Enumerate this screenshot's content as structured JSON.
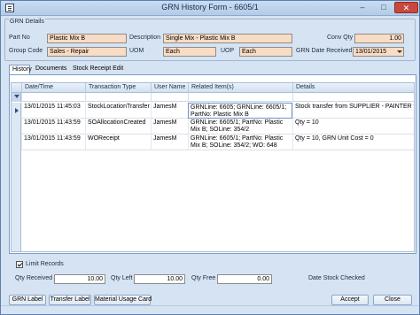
{
  "window": {
    "title": "GRN History Form - 6605/1",
    "close_glyph": "✕",
    "min_glyph": "–",
    "max_glyph": "□"
  },
  "details": {
    "group_title": "GRN Details",
    "part_no_label": "Part No",
    "part_no": "Plastic Mix B",
    "description_label": "Description",
    "description": "Single Mix - Plastic Mix B",
    "conv_qty_label": "Conv Qty",
    "conv_qty": "1.00",
    "group_code_label": "Group Code",
    "group_code": "Sales - Repair",
    "uom_label": "UOM",
    "uom": "Each",
    "uop_label": "UOP",
    "uop": "Each",
    "grn_date_label": "GRN Date Received:",
    "grn_date": "13/01/2015"
  },
  "tabs": [
    {
      "label": "History",
      "active": true
    },
    {
      "label": "Documents",
      "active": false
    },
    {
      "label": "Stock Receipt Edit",
      "active": false
    }
  ],
  "grid": {
    "columns": [
      "Date/Time",
      "Transaction Type",
      "User Name",
      "Related Item(s)",
      "Details"
    ],
    "rows": [
      {
        "datetime": "13/01/2015 11:45:03",
        "type": "StockLocationTransfer",
        "user": "JamesM",
        "related": "GRNLine: 6605; GRNLine: 6605/1; PartNo: Plastic Mix B",
        "details": "Stock transfer from SUPPLIER - PAINTER to"
      },
      {
        "datetime": "13/01/2015 11:43:59",
        "type": "SOAllocationCreated",
        "user": "JamesM",
        "related": "GRNLine: 6605/1; PartNo: Plastic Mix B; SOLine: 354/2",
        "details": "Qty = 10"
      },
      {
        "datetime": "13/01/2015 11:43:59",
        "type": "WOReceipt",
        "user": "JamesM",
        "related": "GRNLine: 6605/1; PartNo: Plastic Mix B; SOLine: 354/2; WO: 648",
        "details": "Qty = 10, GRN Unit Cost = 0"
      }
    ]
  },
  "limit_records": {
    "label": "Limit Records",
    "checked": true
  },
  "summary": {
    "qty_received_label": "Qty Received",
    "qty_received": "10.00",
    "qty_left_label": "Qty Left",
    "qty_left": "10.00",
    "qty_free_label": "Qty Free",
    "qty_free": "0.00",
    "date_stock_checked_label": "Date Stock Checked"
  },
  "buttons": {
    "grn_label": "GRN Label",
    "transfer_label": "Transfer Label",
    "material_usage_card": "Material Usage Card",
    "accept": "Accept",
    "close": "Close"
  }
}
